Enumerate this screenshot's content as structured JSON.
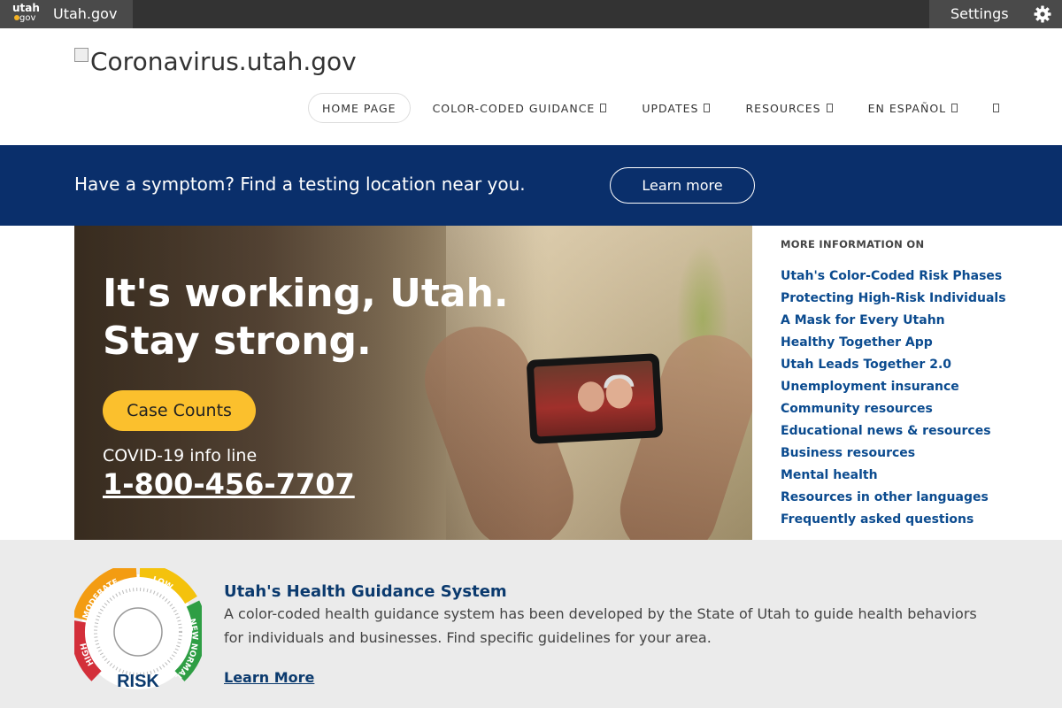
{
  "topbar": {
    "logo_text_top": "utah",
    "logo_text_bottom": "gov",
    "brand_label": "Utah.gov",
    "settings_label": "Settings"
  },
  "header": {
    "logo_alt": "Coronavirus.utah.gov",
    "nav": [
      {
        "label": "HOME PAGE",
        "active": true
      },
      {
        "label": "COLOR-CODED GUIDANCE",
        "has_menu": true
      },
      {
        "label": "UPDATES",
        "has_menu": true
      },
      {
        "label": "RESOURCES",
        "has_menu": true
      },
      {
        "label": "EN ESPAÑOL",
        "has_menu": true
      }
    ],
    "search_icon": "search-icon"
  },
  "banner": {
    "text": "Have a symptom? Find a testing location near you.",
    "button_label": "Learn more"
  },
  "hero": {
    "title_line1": "It's working, Utah.",
    "title_line2": "Stay strong.",
    "button_label": "Case Counts",
    "info_label": "COVID-19 info line",
    "info_phone": "1-800-456-7707"
  },
  "sidebar": {
    "title": "MORE INFORMATION ON",
    "items": [
      "Utah's Color-Coded Risk Phases",
      "Protecting High-Risk Individuals",
      "A Mask for Every Utahn",
      "Healthy Together App",
      "Utah Leads Together 2.0",
      "Unemployment insurance",
      "Community resources",
      "Educational news & resources",
      "Business resources",
      "Mental health",
      "Resources in other languages",
      "Frequently asked questions"
    ]
  },
  "guidance": {
    "title": "Utah's Health Guidance System",
    "text": "A color-coded health guidance system has been developed by the State of Utah to guide health behaviors for individuals and businesses. Find specific guidelines for your area.",
    "link_label": "Learn More",
    "gauge_labels": {
      "high": "HIGH",
      "moderate": "MODERATE",
      "low": "LOW",
      "new_normal": "NEW NORMAL",
      "risk": "RISK"
    }
  },
  "colors": {
    "topbar": "#333333",
    "banner": "#0a2f6b",
    "cta_yellow": "#fbc02d",
    "link_blue": "#0b4b8f",
    "gauge_red": "#d32f3a",
    "gauge_orange": "#f39c12",
    "gauge_yellow": "#f4c20d",
    "gauge_green": "#2e9e44"
  }
}
